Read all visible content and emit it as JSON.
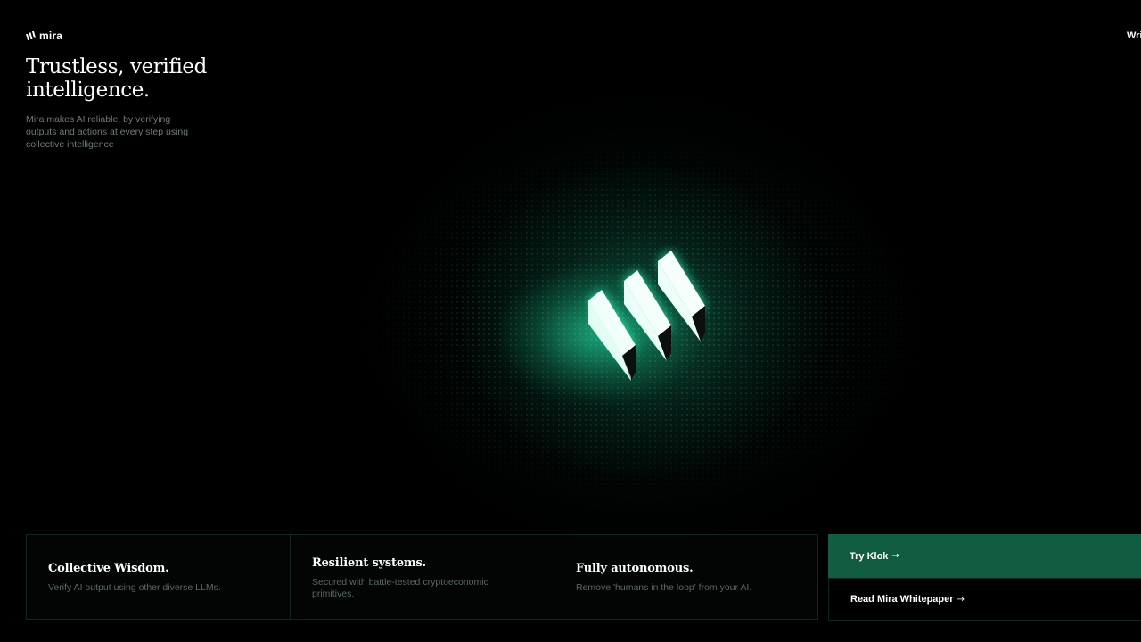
{
  "header": {
    "logo_text": "mira",
    "logo_icon": "mira-logo-icon",
    "nav_link_label": "Wri"
  },
  "hero": {
    "title_line1": "Trustless, verified",
    "title_line2": "intelligence.",
    "subtitle": "Mira makes AI reliable, by verifying outputs and actions at every step using collective intelligence",
    "visual_icon": "mira-3d-logo-icon"
  },
  "features": [
    {
      "title": "Collective Wisdom.",
      "description": "Verify AI output using other diverse LLMs."
    },
    {
      "title": "Resilient systems.",
      "description": "Secured with battle-tested cryptoeconomic primitives."
    },
    {
      "title": "Fully autonomous.",
      "description": "Remove 'humans in the loop' from your AI."
    }
  ],
  "cta": {
    "primary_label": "Try Klok",
    "secondary_label": "Read Mira Whitepaper",
    "arrow": "→"
  },
  "colors": {
    "background": "#000000",
    "accent_green": "#125c42",
    "glow_green": "#28e6aa",
    "muted_text": "#6e7c76",
    "card_border": "#12251e"
  }
}
